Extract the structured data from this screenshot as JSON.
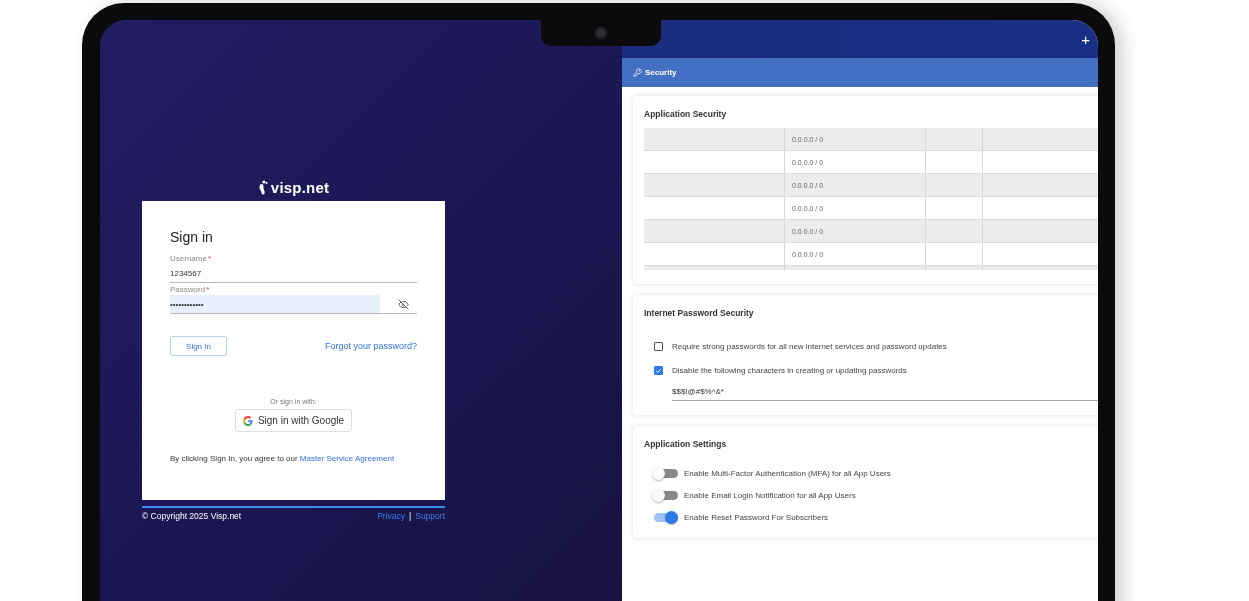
{
  "login": {
    "logo": "visp.net",
    "title": "Sign in",
    "fields": [
      {
        "label": "Username",
        "mark": "*",
        "value": "1234567",
        "kind": "text"
      },
      {
        "label": "Password",
        "mark": "*",
        "value": "••••••••••••",
        "kind": "password"
      }
    ],
    "sign_in_button": "Sign In",
    "forgot_link": "Forgot your password?",
    "alt_label": "Or sign in with:",
    "google_button": "Sign in with Google",
    "agreement": {
      "text": "By clicking Sign In, you agree to our",
      "link": "Master Service Agreement"
    }
  },
  "footer": {
    "copyright": "© Copyright 2025 Visp.net",
    "links": [
      "Privacy",
      "Support"
    ],
    "separator": "|"
  },
  "top_bar": {
    "action": "+"
  },
  "header": {
    "title": "Security"
  },
  "application_security": {
    "title": "Application Security",
    "table": {
      "rows": [
        {
          "column_2": "0.0.0.0 / 0"
        },
        {
          "column_2": "0.0.0.0 / 0"
        },
        {
          "column_2": "0.0.0.0 / 0"
        },
        {
          "column_2": "0.0.0.0 / 0"
        },
        {
          "column_2": "0.0.0.0 / 0"
        },
        {
          "column_2": "0.0.0.0 / 0"
        }
      ]
    }
  },
  "password_security": {
    "title": "Internet Password Security",
    "options": [
      {
        "label": "Require strong passwords for all new internet services and password updates",
        "checked": false
      },
      {
        "label": "Disable the following characters in creating or updating passwords",
        "checked": true
      }
    ],
    "characters": "$$$!@#$%^&*"
  },
  "app_settings": {
    "title": "Application Settings",
    "toggles": [
      {
        "label": "Enable Multi-Factor Authentication (MFA) for all App Users",
        "on": false
      },
      {
        "label": "Enable Email Login Notification for all App Users",
        "on": false
      },
      {
        "label": "Enable Reset Password For Subscribers",
        "on": true
      }
    ]
  }
}
